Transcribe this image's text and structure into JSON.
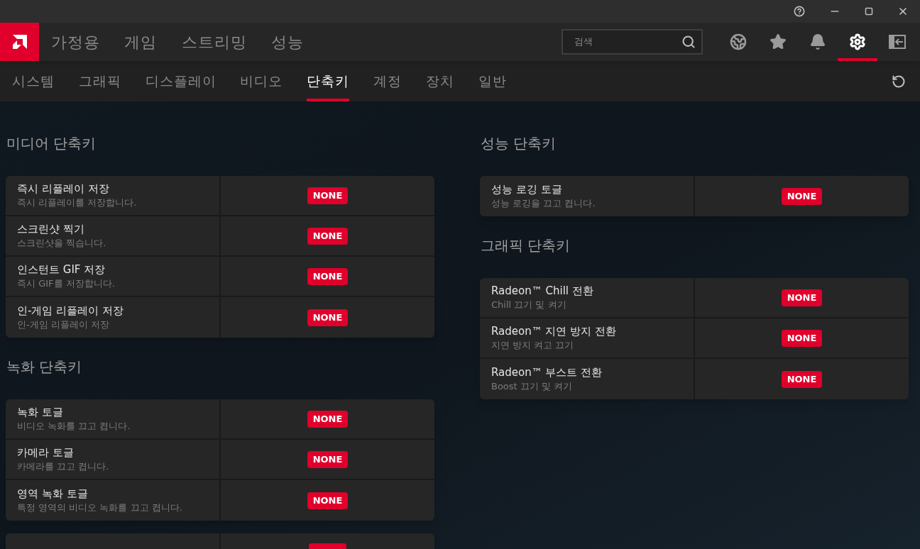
{
  "nav": {
    "tabs": [
      {
        "label": "가정용",
        "selected": false
      },
      {
        "label": "게임",
        "selected": false
      },
      {
        "label": "스트리밍",
        "selected": false
      },
      {
        "label": "성능",
        "selected": false
      }
    ]
  },
  "search": {
    "placeholder": "검색"
  },
  "toolbar": [
    {
      "kind": "globe",
      "selected": false
    },
    {
      "kind": "star",
      "selected": false
    },
    {
      "kind": "bell",
      "selected": false
    },
    {
      "kind": "gear",
      "selected": true
    },
    {
      "kind": "panel",
      "selected": false
    }
  ],
  "subtabs": [
    {
      "label": "시스템",
      "selected": false
    },
    {
      "label": "그래픽",
      "selected": false
    },
    {
      "label": "디스플레이",
      "selected": false
    },
    {
      "label": "비디오",
      "selected": false
    },
    {
      "label": "단축키",
      "selected": true
    },
    {
      "label": "계정",
      "selected": false
    },
    {
      "label": "장치",
      "selected": false
    },
    {
      "label": "일반",
      "selected": false
    }
  ],
  "columns": [
    {
      "sections": [
        {
          "title": "미디어 단축키",
          "rows": [
            {
              "title": "즉시 리플레이 저장",
              "description": "즉시 리플레이를 저장합니다.",
              "hotkey": "NONE"
            },
            {
              "title": "스크린샷 찍기",
              "description": "스크린샷을 찍습니다.",
              "hotkey": "NONE"
            },
            {
              "title": "인스턴트 GIF 저장",
              "description": "즉시 GIF를 저장합니다.",
              "hotkey": "NONE"
            },
            {
              "title": "인-게임 리플레이 저장",
              "description": "인-게임 리플레이 저장",
              "hotkey": "NONE"
            }
          ]
        },
        {
          "title": "녹화 단축키",
          "rows": [
            {
              "title": "녹화 토글",
              "description": "비디오 녹화를 끄고 켭니다.",
              "hotkey": "NONE"
            },
            {
              "title": "카메라 토글",
              "description": "카메라를 끄고 켭니다.",
              "hotkey": "NONE"
            },
            {
              "title": "영역 녹화 토글",
              "description": "특정 영역의 비디오 녹화를 끄고 켭니다.",
              "hotkey": "NONE"
            }
          ]
        },
        {
          "rows": [
            {
              "partial": true
            }
          ]
        }
      ]
    },
    {
      "sections": [
        {
          "title": "성능 단축키",
          "rows": [
            {
              "title": "성능 로깅 토글",
              "description": "성능 로깅을 끄고 켭니다.",
              "hotkey": "NONE"
            }
          ]
        },
        {
          "title": "그래픽 단축키",
          "rows": [
            {
              "title": "Radeon™ Chill 전환",
              "description": "Chill 끄기 및 켜기",
              "hotkey": "NONE"
            },
            {
              "title": "Radeon™ 지연 방지 전환",
              "description": "지연 방지 켜고 끄기",
              "hotkey": "NONE"
            },
            {
              "title": "Radeon™ 부스트 전환",
              "description": "Boost 끄기 및 켜기",
              "hotkey": "NONE"
            }
          ]
        }
      ]
    }
  ]
}
